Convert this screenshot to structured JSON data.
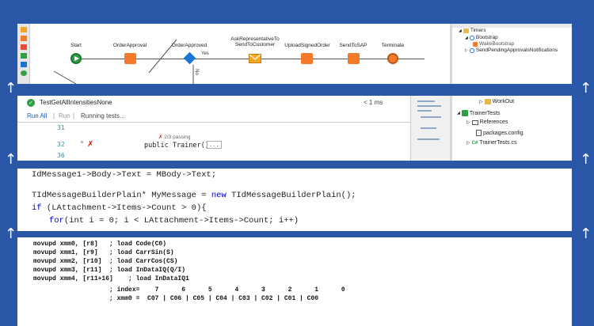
{
  "workflow": {
    "nodes": [
      {
        "label": "Start"
      },
      {
        "label": "OrderApproval"
      },
      {
        "label": "OrderApproved"
      },
      {
        "label": "AskRepresentativeTo",
        "label2": "SendToCustomer"
      },
      {
        "label": "UploadSignedOrder"
      },
      {
        "label": "SendToSAP"
      },
      {
        "label": "Terminate"
      }
    ],
    "yes_label": "Yes",
    "no_label": "No",
    "tree": {
      "timers": "Timers",
      "bootstrap": "Bootstrap",
      "wake_bootstrap": "WakeBootstrap",
      "send_pending": "SendPendingApprovalsNotifications"
    }
  },
  "test_runner": {
    "test_name": "TestGetAllIntensitiesNone",
    "duration": "< 1 ms",
    "run_all": "Run All",
    "run": "Run",
    "running": "Running tests...",
    "lines": [
      {
        "num": "31",
        "text": ""
      },
      {
        "num": "32",
        "text": "public Trainer()"
      },
      {
        "num": "36",
        "text": ""
      }
    ],
    "codelens": "2/3 passing",
    "collapsed": "...",
    "solution": {
      "workout": "WorkOut",
      "project": "TrainerTests",
      "references": "References",
      "packages": "packages.config",
      "trainer_tests_cs": "TrainerTests.cs",
      "cs_badge": "C#"
    }
  },
  "cpp_code": {
    "line1": "IdMessage1->Body->Text = MBody->Text;",
    "line2_a": "TIdMessageBuilderPlain* MyMessage = ",
    "line2_kw": "new",
    "line2_b": " TIdMessageBuilderPlain();",
    "line3_kw": "if",
    "line3_b": " (LAttachment->Items->Count > 0){",
    "line4_kw": "for",
    "line4_b": "(int i = 0; i < LAttachment->Items->Count; i++)"
  },
  "asm_code": {
    "lines": [
      "movupd xmm0, [r8]   ; load Code(C0)",
      "movupd xmm1, [r9]   ; load CarrSin(S)",
      "movupd xmm2, [r10]  ; load CarrCos(CS)",
      "movupd xmm3, [r11]  ; load InDataIQ(Q/I)",
      "movupd xmm4, [r11+16]    ; load InDataIQ1",
      "                    ; index=    7      6      5      4      3      2      1      0",
      "                    ; xmm0 =  C07 | C06 | C05 | C04 | C03 | C02 | C01 | C00"
    ]
  },
  "icons": {
    "up_arrow": "↑",
    "check": "✓",
    "fail": "✗",
    "expand": "▷",
    "collapse": "◢"
  },
  "colors": {
    "background": "#2b57a8",
    "start": "#2ea043",
    "activity": "#f47a2a",
    "decision": "#1a74d6",
    "keyword": "#0000c0"
  }
}
